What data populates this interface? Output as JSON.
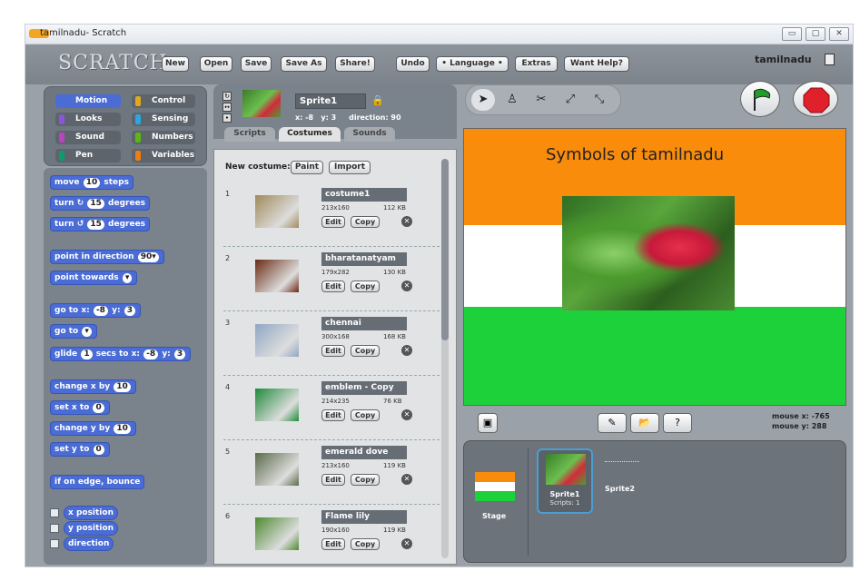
{
  "window": {
    "title": "tamilnadu- Scratch",
    "controls": [
      "▭",
      "▢",
      "✕"
    ]
  },
  "menu": {
    "logo": "SCRATCH",
    "buttons": [
      "New",
      "Open",
      "Save",
      "Save As",
      "Share!",
      "Undo",
      "• Language •",
      "Extras",
      "Want Help?"
    ],
    "project": "tamilnadu"
  },
  "categories": [
    {
      "label": "Motion",
      "color": "#4a6cd4"
    },
    {
      "label": "Control",
      "color": "#e1a91a"
    },
    {
      "label": "Looks",
      "color": "#8a55d7"
    },
    {
      "label": "Sensing",
      "color": "#2ca5e2"
    },
    {
      "label": "Sound",
      "color": "#bb42c3"
    },
    {
      "label": "Numbers",
      "color": "#5cb712"
    },
    {
      "label": "Pen",
      "color": "#0e9a6c"
    },
    {
      "label": "Variables",
      "color": "#ee7d16"
    }
  ],
  "blocks": [
    {
      "pre": "move",
      "v1": "10",
      "mid": "steps"
    },
    {
      "pre": "turn ↻",
      "v1": "15",
      "mid": "degrees"
    },
    {
      "pre": "turn ↺",
      "v1": "15",
      "mid": "degrees"
    },
    {
      "pre": "point in direction",
      "v1": "90▾",
      "mid": ""
    },
    {
      "pre": "point towards",
      "v1": "▾",
      "mid": ""
    },
    {
      "pre": "go to x:",
      "v1": "-8",
      "mid": "y:",
      "v2": "3"
    },
    {
      "pre": "go to",
      "v1": "▾",
      "mid": ""
    },
    {
      "pre": "glide",
      "v1": "1",
      "mid": "secs to x:",
      "v2": "-8",
      "post": "y:",
      "v3": "3"
    },
    {
      "pre": "change x by",
      "v1": "10",
      "mid": ""
    },
    {
      "pre": "set x to",
      "v1": "0",
      "mid": ""
    },
    {
      "pre": "change y by",
      "v1": "10",
      "mid": ""
    },
    {
      "pre": "set y to",
      "v1": "0",
      "mid": ""
    },
    {
      "pre": "if on edge, bounce",
      "v1": "",
      "mid": ""
    }
  ],
  "reporters": [
    "x position",
    "y position",
    "direction"
  ],
  "sprite": {
    "name": "Sprite1",
    "x_label": "x: -8",
    "y_label": "y: 3",
    "direction_label": "direction: 90"
  },
  "tabs": [
    "Scripts",
    "Costumes",
    "Sounds"
  ],
  "costumes_pane": {
    "new_label": "New costume:",
    "paint": "Paint",
    "import": "Import",
    "edit": "Edit",
    "copy": "Copy",
    "items": [
      {
        "num": "1",
        "name": "costume1",
        "dim": "213x160",
        "size": "112 KB",
        "color": "#a08a5a"
      },
      {
        "num": "2",
        "name": "bharatanatyam",
        "dim": "179x282",
        "size": "130 KB",
        "color": "#6b2a14"
      },
      {
        "num": "3",
        "name": "chennai",
        "dim": "300x168",
        "size": "168 KB",
        "color": "#8fa7c4"
      },
      {
        "num": "4",
        "name": "emblem - Copy",
        "dim": "214x235",
        "size": "76 KB",
        "color": "#1f8a3a"
      },
      {
        "num": "5",
        "name": "emerald dove",
        "dim": "213x160",
        "size": "119 KB",
        "color": "#5a6a4a"
      },
      {
        "num": "6",
        "name": "Flame lily",
        "dim": "190x160",
        "size": "119 KB",
        "color": "#4d8a30"
      }
    ]
  },
  "stage": {
    "title": "Symbols of tamilnadu",
    "mouse_x": "mouse x: -765",
    "mouse_y": "mouse y: 288",
    "flag_color": "#1f9e2a",
    "stop_color": "#e0202a"
  },
  "sprites_pane": {
    "stage_label": "Stage",
    "selected": "Sprite1",
    "selected_scripts": "Scripts: 1",
    "other": "Sprite2"
  }
}
